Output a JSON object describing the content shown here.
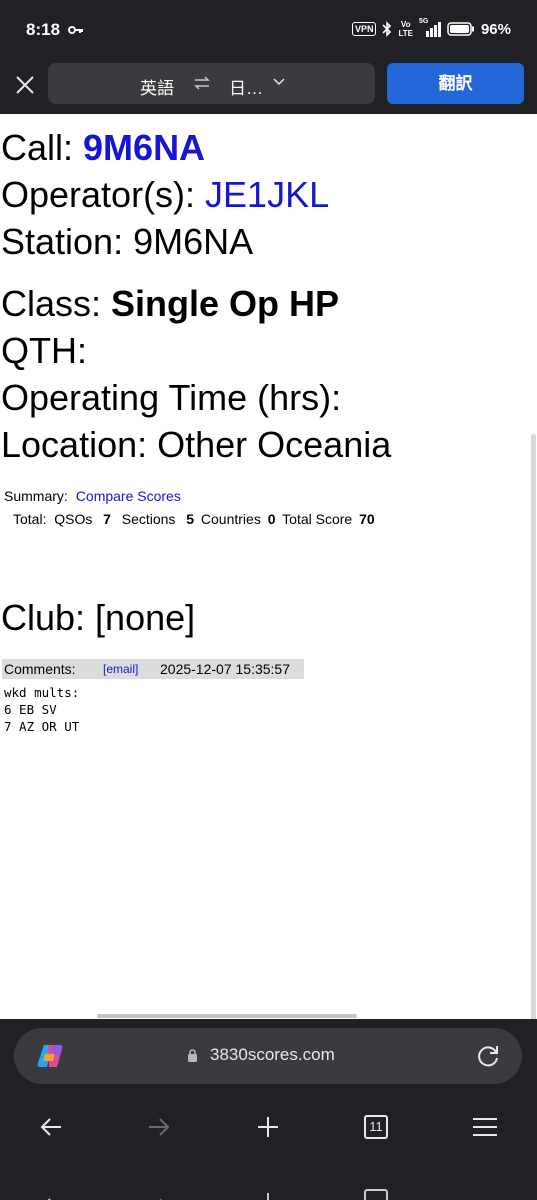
{
  "status_bar": {
    "time": "8:18",
    "icons": [
      "key-icon",
      "vpn-icon",
      "bluetooth-icon",
      "volte-icon",
      "5g-signal-icon",
      "battery-icon"
    ],
    "vpn": "VPN",
    "volte_top": "Vo",
    "volte_bottom": "LTE",
    "network": "5G",
    "battery": "96%"
  },
  "translate_bar": {
    "source_lang": "英語",
    "target_lang": "日…",
    "translate_button": "翻訳"
  },
  "page": {
    "call_label": "Call: ",
    "call_value": "9M6NA",
    "operators_label": "Operator(s): ",
    "operators_value": "JE1JKL",
    "station_label": "Station: ",
    "station_value": "9M6NA",
    "class_label": "Class: ",
    "class_value": "Single Op HP",
    "qth_label": "QTH:",
    "operating_time_label": "Operating Time (hrs):",
    "location_label": "Location: ",
    "location_value": "Other Oceania",
    "summary_label": "Summary:",
    "compare_link": "Compare Scores",
    "totals": {
      "total_label": "Total:",
      "qsos_label": "QSOs",
      "qsos_value": "7",
      "sections_label": "Sections",
      "sections_value": "5",
      "countries_label": "Countries",
      "countries_value": "0",
      "score_label": "Total Score",
      "score_value": "70"
    },
    "club_label": "Club: ",
    "club_value": "[none]",
    "comments_label": "Comments:",
    "email_link": "[email]",
    "timestamp": "2025-12-07 15:35:57",
    "comment_lines": [
      "wkd mults:",
      "6 EB SV",
      "7 AZ OR UT"
    ]
  },
  "bottom_bar": {
    "url": "3830scores.com",
    "tab_count": "11"
  },
  "colors": {
    "chrome_bg": "#202124",
    "pill_bg": "#3a3b3e",
    "translate_button": "#2467d8",
    "link": "#1515d6"
  }
}
